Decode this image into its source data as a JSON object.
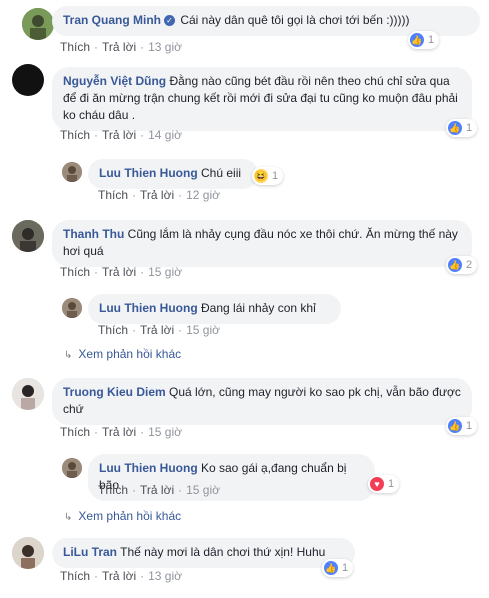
{
  "actions": {
    "like": "Thích",
    "reply": "Trả lời"
  },
  "comments": [
    {
      "name": "Tran Quang Minh",
      "verified": "✓",
      "text": "Cái này dân quê tôi gọi là chơi tới bến :)))))",
      "time": "13 giờ",
      "reaction": "like",
      "count": "1"
    },
    {
      "name": "Nguyễn Việt Dũng",
      "text": "Đằng nào cũng bét đầu rồi nên theo chú chỉ sửa qua để đi ăn mừng trận chung kết rồi mới đi sửa đại tu cũng ko muộn đâu phải ko cháu dâu .",
      "time": "14 giờ",
      "reaction": "like",
      "count": "1"
    },
    {
      "name": "Luu Thien Huong",
      "text": "Chú eiii",
      "time": "12 giờ",
      "reaction": "haha",
      "count": "1"
    },
    {
      "name": "Thanh Thu",
      "text": "Cũng lắm là nhảy cụng đầu nóc xe thôi chứ. Ăn mừng thế này hơi quá",
      "time": "15 giờ",
      "reaction": "like",
      "count": "2"
    },
    {
      "name": "Luu Thien Huong",
      "text": "Đang lái nhảy con khỉ",
      "time": "15 giờ"
    },
    {
      "name": "Truong Kieu Diem",
      "text": "Quá lớn, cũng may người ko sao pk chị, vẫn bão được chứ",
      "time": "15 giờ",
      "reaction": "like",
      "count": "1"
    },
    {
      "name": "Luu Thien Huong",
      "text": "Ko sao gái ạ,đang chuẩn bị bão",
      "time": "15 giờ",
      "reaction": "love",
      "count": "1"
    },
    {
      "name": "LiLu Tran",
      "text": "Thế này mơi là dân chơi thứ xịn! Huhu",
      "time": "13 giờ",
      "reaction": "like",
      "count": "1"
    }
  ],
  "more_replies": [
    "Xem phản hồi khác",
    "Xem phản hồi khác"
  ],
  "icons": {
    "like": "thumbs-up-icon",
    "haha": "haha-icon",
    "love": "heart-icon",
    "more": "reply-arrow-icon"
  },
  "colors": {
    "name": "#385898",
    "bubble": "#f2f3f5",
    "meta": "#90949c",
    "like": "#4f80ff",
    "love": "#f33e58"
  }
}
